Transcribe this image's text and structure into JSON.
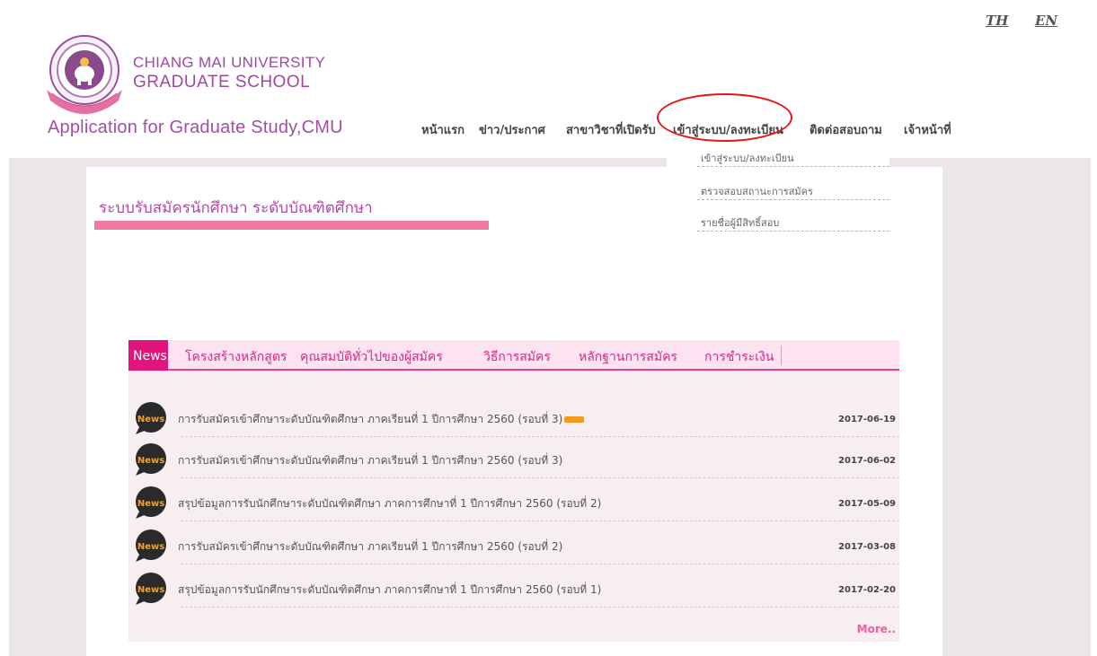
{
  "header": {
    "lang_th": "TH",
    "lang_en": "EN",
    "brand_line1": "CHIANG MAI UNIVERSITY",
    "brand_line2": "GRADUATE SCHOOL",
    "app_title": "Application for Graduate Study,CMU"
  },
  "nav": {
    "items": [
      {
        "label": "หน้าแรก"
      },
      {
        "label": "ข่าว/ประกาศ"
      },
      {
        "label": "สาขาวิชาที่เปิดรับ"
      },
      {
        "label": "เข้าสู่ระบบ/ลงทะเบียน"
      },
      {
        "label": "ติดต่อสอบถาม"
      },
      {
        "label": "เจ้าหน้าที่"
      }
    ],
    "dropdown": [
      {
        "label": "เข้าสู่ระบบ/ลงทะเบียน"
      },
      {
        "label": "ตรวจสอบสถานะการสมัคร"
      },
      {
        "label": "รายชื่อผู้มีสิทธิ์สอบ"
      }
    ]
  },
  "main": {
    "heading": "ระบบรับสมัครนักศึกษา ระดับบัณฑิตศึกษา"
  },
  "news": {
    "tabs": [
      {
        "label": "News"
      },
      {
        "label": "โครงสร้างหลักสูตร"
      },
      {
        "label": "คุณสมบัติทั่วไปของผู้สมัคร"
      },
      {
        "label": "วิธีการสมัคร"
      },
      {
        "label": "หลักฐานการสมัคร"
      },
      {
        "label": "การชำระเงิน"
      }
    ],
    "icon_text": "News",
    "items": [
      {
        "title": "การรับสมัครเข้าศึกษาระดับบัณฑิตศึกษา ภาคเรียนที่ 1 ปีการศึกษา 2560 (รอบที่ 3)",
        "date": "2017-06-19",
        "is_new": true
      },
      {
        "title": "การรับสมัครเข้าศึกษาระดับบัณฑิตศึกษา ภาคเรียนที่ 1 ปีการศึกษา 2560 (รอบที่ 3)",
        "date": "2017-06-02"
      },
      {
        "title": "สรุปข้อมูลการรับนักศึกษาระดับบัณฑิตศึกษา ภาคการศึกษาที่ 1 ปีการศึกษา 2560 (รอบที่ 2)",
        "date": "2017-05-09"
      },
      {
        "title": "การรับสมัครเข้าศึกษาระดับบัณฑิตศึกษา ภาคเรียนที่ 1 ปีการศึกษา 2560 (รอบที่ 2)",
        "date": "2017-03-08"
      },
      {
        "title": "สรุปข้อมูลการรับนักศึกษาระดับบัณฑิตศึกษา ภาคการศึกษาที่ 1 ปีการศึกษา 2560 (รอบที่ 1)",
        "date": "2017-02-20"
      }
    ],
    "more": "More.."
  },
  "colors": {
    "brand_purple": "#9b4a9e",
    "accent_pink": "#e0147b",
    "heading_bar": "#f07aa4",
    "highlight_circle": "#e8141c"
  }
}
